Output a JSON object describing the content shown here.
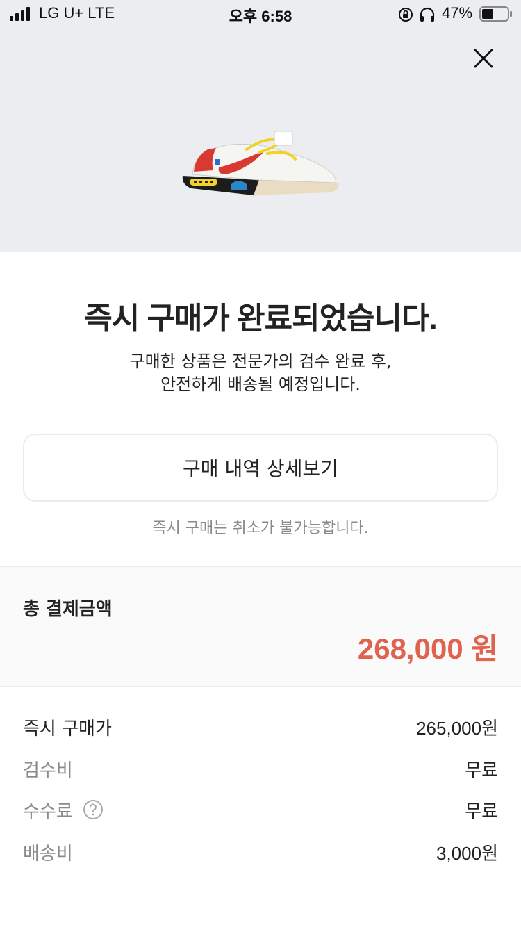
{
  "status_bar": {
    "carrier": "LG U+  LTE",
    "time": "오후 6:58",
    "battery": "47%",
    "icons": [
      "signal-icon",
      "orientation-lock-icon",
      "headphones-icon",
      "battery-icon"
    ]
  },
  "hero": {
    "close_icon": "close-icon",
    "product_image": "sneaker-image",
    "background_color": "#ebedf1"
  },
  "message": {
    "title": "즉시 구매가 완료되었습니다.",
    "desc_line1": "구매한 상품은 전문가의 검수 완료 후,",
    "desc_line2": "안전하게 배송될 예정입니다."
  },
  "detail_button": {
    "label": "구매 내역 상세보기"
  },
  "notice": "즉시 구매는 취소가 불가능합니다.",
  "total": {
    "label": "총 결제금액",
    "amount": "268,000 원",
    "amount_color": "#e06350"
  },
  "breakdown": [
    {
      "label": "즉시 구매가",
      "value": "265,000원"
    },
    {
      "label": "검수비",
      "value": "무료"
    },
    {
      "label": "수수료",
      "value": "무료",
      "help_icon": "question-circle-icon"
    },
    {
      "label": "배송비",
      "value": "3,000원"
    }
  ]
}
